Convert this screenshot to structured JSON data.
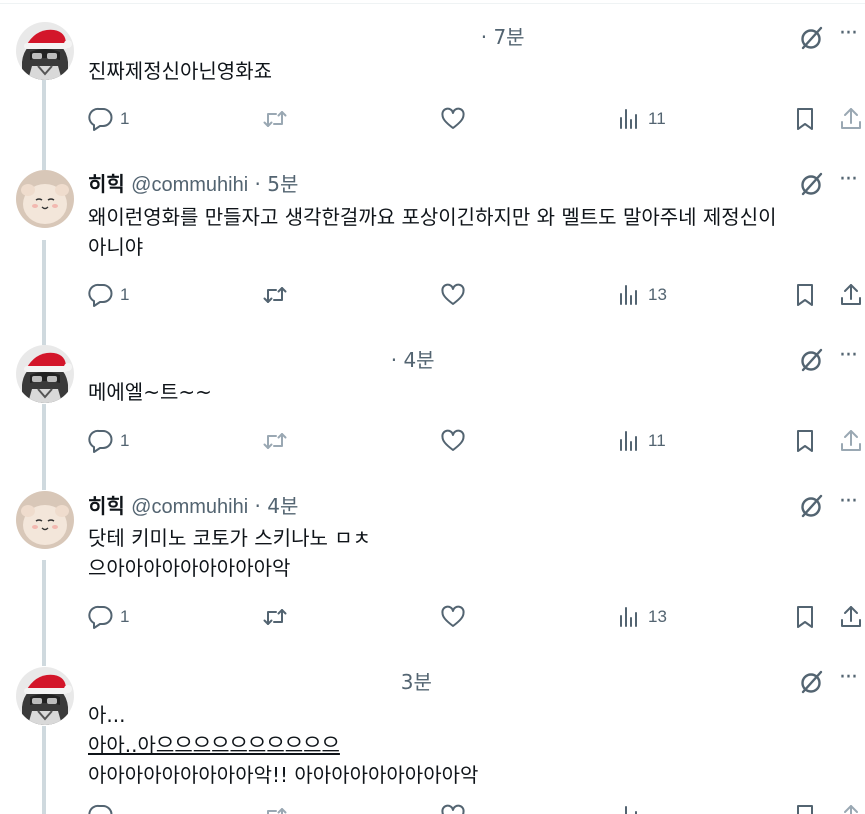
{
  "tweets": [
    {
      "name": "",
      "handle": "",
      "time": "7분",
      "hidden_author": true,
      "lines": [
        "진짜제정신아닌영화죠"
      ],
      "replies": "1",
      "views": "11",
      "avatar": "santa-hat-avatar"
    },
    {
      "name": "히힉",
      "handle": "@commuhihi",
      "time": "5분",
      "hidden_author": false,
      "lines": [
        "왜이런영화를 만들자고 생각한걸까요 포상이긴하지만 와 멜트도 말아주네 제정신이",
        "아니야"
      ],
      "replies": "1",
      "views": "13",
      "avatar": "plush-avatar"
    },
    {
      "name": "",
      "handle": "",
      "time": "4분",
      "hidden_author": true,
      "lines": [
        "메에엘~트~~"
      ],
      "replies": "1",
      "views": "11",
      "avatar": "santa-hat-avatar"
    },
    {
      "name": "히힉",
      "handle": "@commuhihi",
      "time": "4분",
      "hidden_author": false,
      "lines": [
        "닷테 키미노 코토가 스키나노 ㅁㅊ",
        "으아아아아아아아아아악"
      ],
      "replies": "1",
      "views": "13",
      "avatar": "plush-avatar"
    },
    {
      "name": "",
      "handle": "",
      "time": "3분",
      "hidden_author": true,
      "lines": [
        "아...",
        "아아..아으으으으으으으으으으",
        "아아아아아아아아아악!! 아아아아아아아아아악"
      ],
      "replies": "",
      "views": "",
      "avatar": "santa-hat-avatar"
    }
  ],
  "separator": "·",
  "icons": {
    "reply": "reply-icon",
    "retweet": "retweet-icon",
    "like": "heart-icon",
    "views": "views-chart-icon",
    "bookmark": "bookmark-icon",
    "share": "share-icon",
    "grok": "grok-icon",
    "more": "more-icon"
  },
  "colors": {
    "text": "#0f1419",
    "secondary": "#536471",
    "thread_line": "#cfd9de",
    "hat_red": "#d3162a"
  }
}
